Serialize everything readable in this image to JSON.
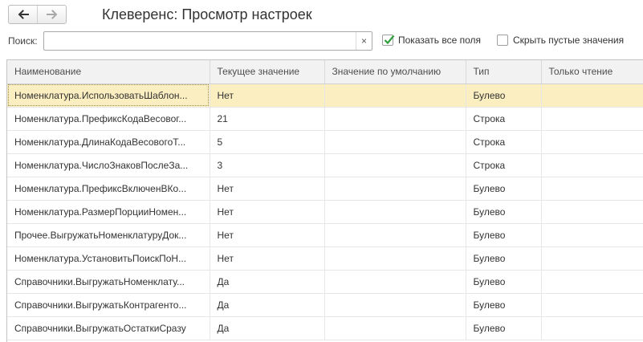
{
  "window": {
    "title": "Клеверенс: Просмотр настроек"
  },
  "nav": {
    "back_icon": "arrow-left-icon",
    "forward_icon": "arrow-right-icon"
  },
  "search": {
    "label": "Поиск:",
    "value": "",
    "placeholder": "",
    "clear_glyph": "×"
  },
  "filters": {
    "show_all_fields": {
      "label": "Показать все поля",
      "checked": true
    },
    "hide_empty_values": {
      "label": "Скрыть пустые значения",
      "checked": false
    }
  },
  "table": {
    "columns": [
      "Наименование",
      "Текущее значение",
      "Значение по умолчанию",
      "Тип",
      "Только чтение"
    ],
    "selected_row": 0,
    "rows": [
      [
        "Номенклатура.ИспользоватьШаблон...",
        "Нет",
        "",
        "Булево",
        ""
      ],
      [
        "Номенклатура.ПрефиксКодаВесовог...",
        "21",
        "",
        "Строка",
        ""
      ],
      [
        "Номенклатура.ДлинаКодаВесовогоТ...",
        "5",
        "",
        "Строка",
        ""
      ],
      [
        "Номенклатура.ЧислоЗнаковПослеЗа...",
        "3",
        "",
        "Строка",
        ""
      ],
      [
        "Номенклатура.ПрефиксВключенВКо...",
        "Нет",
        "",
        "Булево",
        ""
      ],
      [
        "Номенклатура.РазмерПорцииНомен...",
        "Нет",
        "",
        "Булево",
        ""
      ],
      [
        "Прочее.ВыгружатьНоменклатуруДок...",
        "Нет",
        "",
        "Булево",
        ""
      ],
      [
        "Номенклатура.УстановитьПоискПоН...",
        "Нет",
        "",
        "Булево",
        ""
      ],
      [
        "Справочники.ВыгружатьНоменклату...",
        "Да",
        "",
        "Булево",
        ""
      ],
      [
        "Справочники.ВыгружатьКонтрагенто...",
        "Да",
        "",
        "Булево",
        ""
      ],
      [
        "Справочники.ВыгружатьОстаткиСразу",
        "Да",
        "",
        "Булево",
        ""
      ]
    ]
  },
  "colors": {
    "selected_row": "#fbeec0",
    "check_mark": "#2e9e3a",
    "header_bg": "#f2f2f2"
  }
}
